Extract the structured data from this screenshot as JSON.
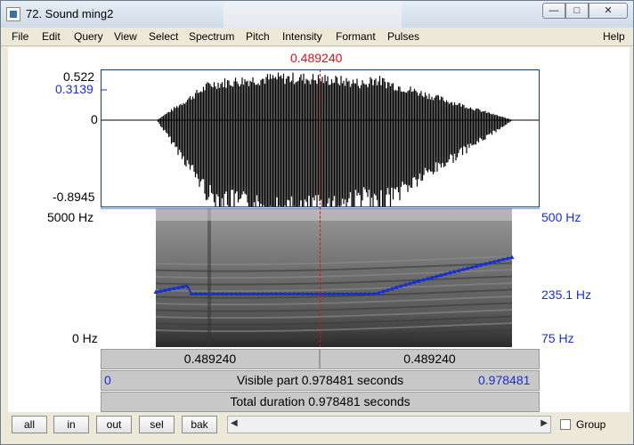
{
  "window": {
    "title": "72. Sound ming2",
    "controls": {
      "minimize": "—",
      "maximize": "□",
      "close": "✕"
    }
  },
  "menu": [
    "File",
    "Edit",
    "Query",
    "View",
    "Select",
    "Spectrum",
    "Pitch",
    "Intensity",
    "Formant",
    "Pulses",
    "Help"
  ],
  "cursor_time": "0.489240",
  "waveform": {
    "max_label": "0.522",
    "cursor_amp_label": "0.3139",
    "zero_label": "0",
    "min_label": "-0.8945"
  },
  "spectrogram": {
    "freq_max_label": "5000 Hz",
    "freq_min_label": "0 Hz",
    "pitch_max_label": "500 Hz",
    "pitch_cursor_label": "235.1 Hz",
    "pitch_min_label": "75 Hz"
  },
  "time_bars": {
    "left_segment": "0.489240",
    "right_segment": "0.489240",
    "visible_start": "0",
    "visible_text": "Visible part 0.978481 seconds",
    "visible_end": "0.978481",
    "total_text": "Total duration 0.978481 seconds"
  },
  "buttons": {
    "all": "all",
    "in": "in",
    "out": "out",
    "sel": "sel",
    "bak": "bak"
  },
  "group_label": "Group",
  "colors": {
    "pitch": "#1a2fd0",
    "cursor": "#e01010",
    "accent": "#1a2fd0"
  }
}
